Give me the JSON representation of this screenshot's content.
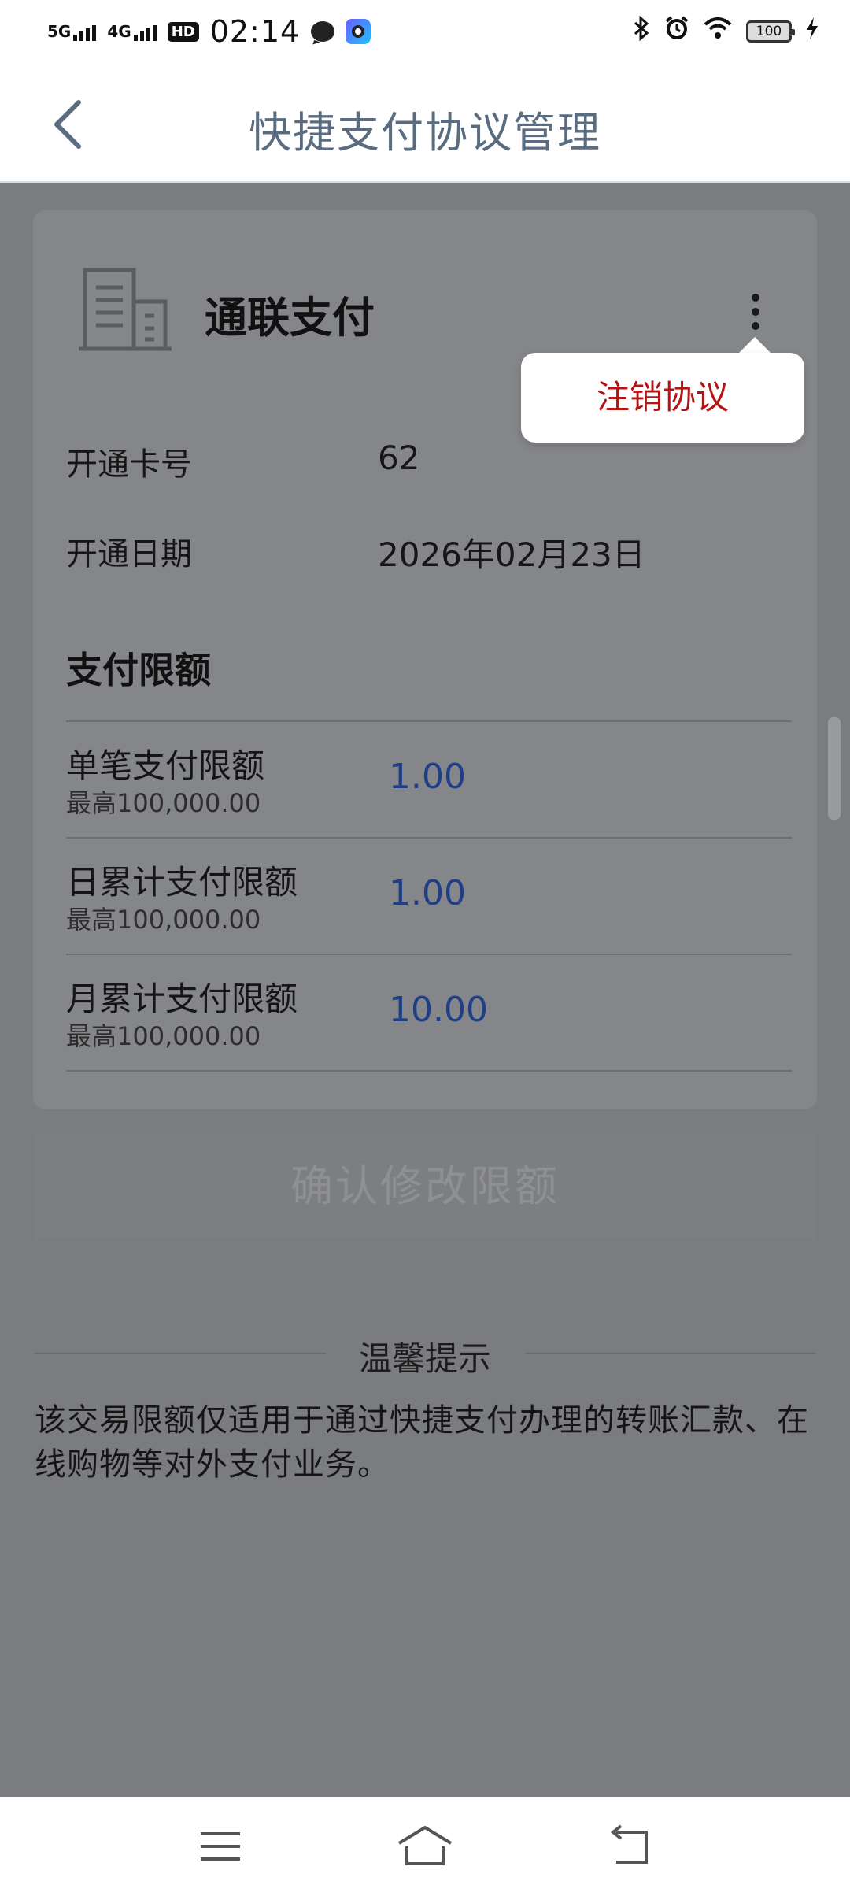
{
  "status_bar": {
    "net1": "5G",
    "net2": "4G",
    "hd": "HD",
    "time": "02:14",
    "battery": "100"
  },
  "header": {
    "title": "快捷支付协议管理"
  },
  "card": {
    "bank_name": "通联支付",
    "card_label": "开通卡号",
    "card_value": "62",
    "date_label": "开通日期",
    "date_value": "2026年02月23日",
    "limits_title": "支付限额",
    "limits": [
      {
        "label": "单笔支付限额",
        "sub": "最高100,000.00",
        "value": "1.00"
      },
      {
        "label": "日累计支付限额",
        "sub": "最高100,000.00",
        "value": "1.00"
      },
      {
        "label": "月累计支付限额",
        "sub": "最高100,000.00",
        "value": "10.00"
      }
    ]
  },
  "popup": {
    "item": "注销协议"
  },
  "confirm_button": "确认修改限额",
  "tips": {
    "title": "温馨提示",
    "text": "该交易限额仅适用于通过快捷支付办理的转账汇款、在线购物等对外支付业务。"
  },
  "colors": {
    "overlay": "#7b7c7f",
    "title": "#5a6d80",
    "limit_value": "#1e3e86",
    "danger": "#b31414"
  }
}
